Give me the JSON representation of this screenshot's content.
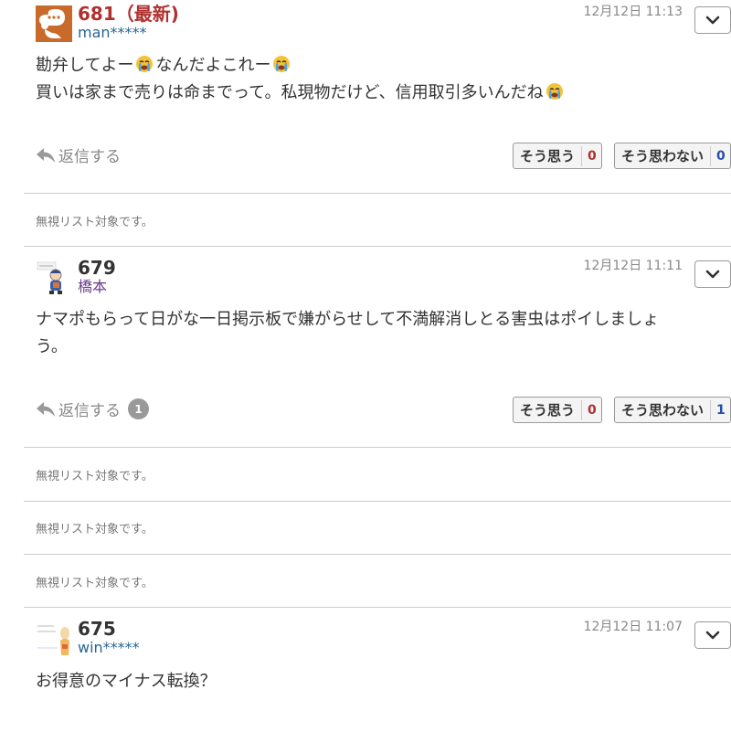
{
  "comments": [
    {
      "number": "681（最新)",
      "user": "man*****",
      "time": "12月12日 11:13",
      "lines": [
        "勘弁してよー",
        "なんだよこれー",
        "買いは家まで売りは命までって。私現物だけど、信用取引多いんだね"
      ],
      "reply_label": "返信する",
      "agree_label": "そう思う",
      "agree_count": "0",
      "disagree_label": "そう思わない",
      "disagree_count": "0"
    },
    {
      "number": "679",
      "user": "橋本",
      "time": "12月12日 11:11",
      "lines": [
        "ナマポもらって日がな一日掲示板で嫌がらせして不満解消しとる害虫はポイしましょ",
        "う。"
      ],
      "reply_label": "返信する",
      "reply_count": "1",
      "agree_label": "そう思う",
      "agree_count": "0",
      "disagree_label": "そう思わない",
      "disagree_count": "1"
    },
    {
      "number": "675",
      "user": "win*****",
      "time": "12月12日 11:07",
      "lines": [
        "お得意のマイナス転換？"
      ]
    }
  ],
  "ignored_notices": [
    "無視リスト対象です。",
    "無視リスト対象です。",
    "無視リスト対象です。",
    "無視リスト対象です。"
  ],
  "icons": {
    "reply": "reply-arrow-icon",
    "menu": "chevron-down-icon",
    "emoji": "crying-face-icon"
  },
  "colors": {
    "latest_number": "#b03030",
    "username": "#2a6496",
    "agree_count": "#b03030",
    "disagree_count": "#2a4fa8"
  }
}
